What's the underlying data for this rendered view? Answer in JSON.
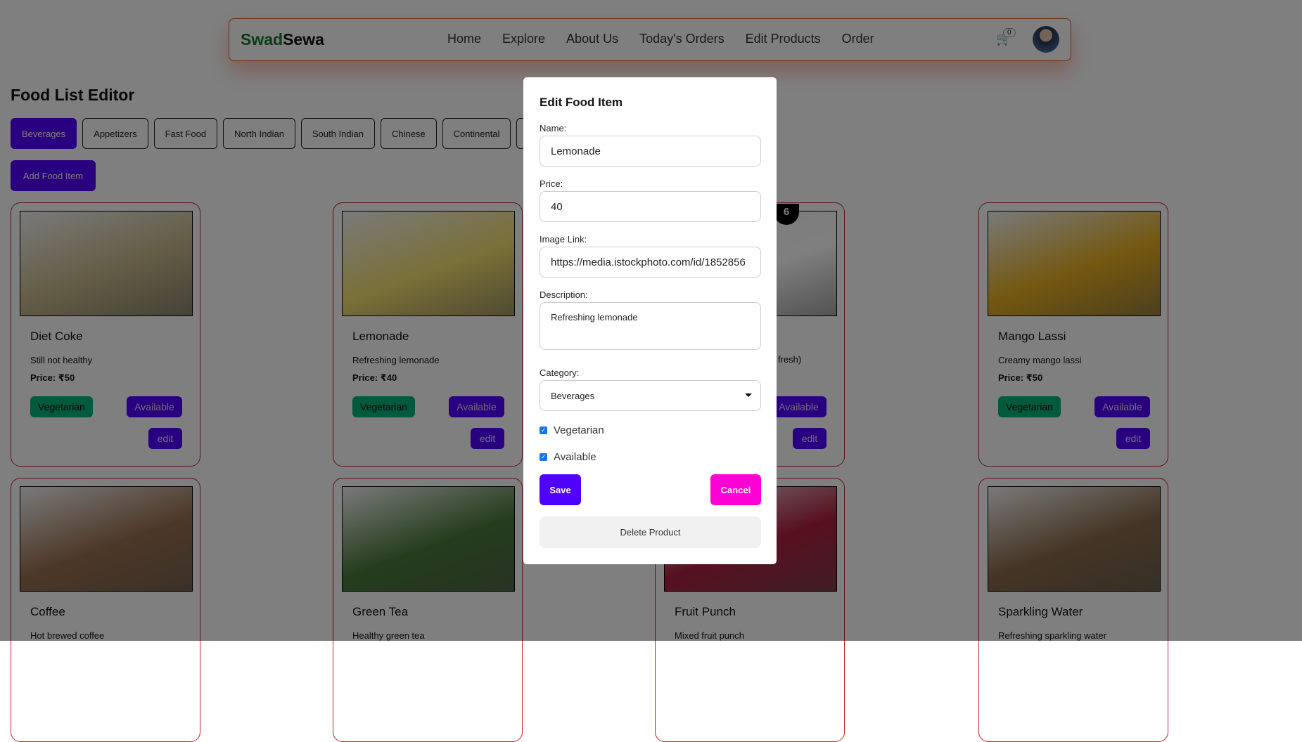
{
  "navbar": {
    "logo_a": "Swad",
    "logo_b": "Sewa",
    "links": [
      "Home",
      "Explore",
      "About Us",
      "Today's Orders",
      "Edit Products",
      "Order"
    ],
    "cart_count": "0"
  },
  "page_title": "Food List Editor",
  "categories": [
    "Beverages",
    "Appetizers",
    "Fast Food",
    "North Indian",
    "South Indian",
    "Chinese",
    "Continental"
  ],
  "add_button": "Add Food Item",
  "card_labels": {
    "vegetarian": "Vegetarian",
    "available": "Available",
    "edit": "edit"
  },
  "cards": [
    {
      "name": "Diet Coke",
      "desc": "Still not healthy",
      "price": "Price: ₹50",
      "color": "#c9b98a"
    },
    {
      "name": "Lemonade",
      "desc": "Refreshing lemonade",
      "price": "Price: ₹40",
      "color": "#f4e070"
    },
    {
      "name": "",
      "desc": "",
      "price": "",
      "color": "#ffffff"
    },
    {
      "name": "Mango Lassi",
      "desc": "Creamy mango lassi",
      "price": "Price: ₹50",
      "color": "#e8b020"
    },
    {
      "name": "Coffee",
      "desc": "Hot brewed coffee",
      "color": "#9a7050"
    },
    {
      "name": "Green Tea",
      "desc": "Healthy green tea",
      "color": "#4a7a3a"
    },
    {
      "name": "Fruit Punch",
      "desc": "Mixed fruit punch",
      "color": "#b02040"
    },
    {
      "name": "Sparkling Water",
      "desc": "Refreshing sparkling water",
      "color": "#8a6a4a"
    }
  ],
  "hidden_card": {
    "desc_fragment": "fresh)",
    "badge": "6"
  },
  "modal": {
    "title": "Edit Food Item",
    "name_label": "Name:",
    "name_value": "Lemonade",
    "price_label": "Price:",
    "price_value": "40",
    "image_label": "Image Link:",
    "image_value": "https://media.istockphoto.com/id/1852856",
    "desc_label": "Description:",
    "desc_value": "Refreshing lemonade",
    "category_label": "Category:",
    "category_value": "Beverages",
    "vegetarian_label": "Vegetarian",
    "vegetarian_checked": true,
    "available_label": "Available",
    "available_checked": true,
    "save": "Save",
    "cancel": "Cancel",
    "delete": "Delete Product"
  }
}
